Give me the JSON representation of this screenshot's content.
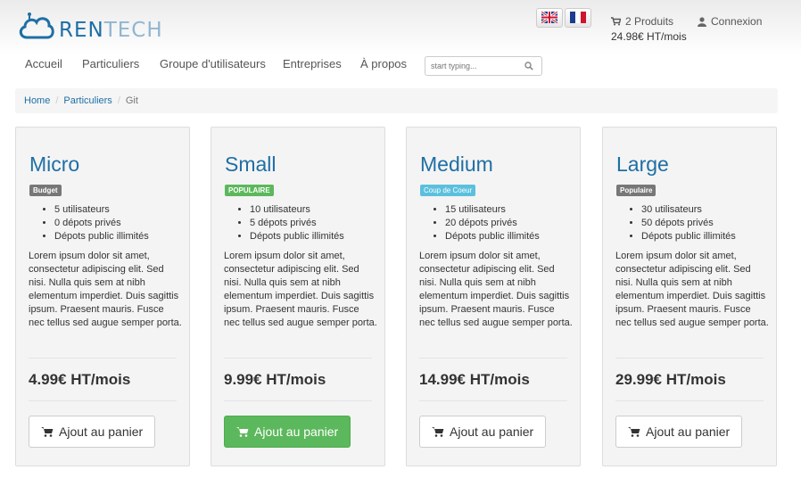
{
  "brand": {
    "logo_text_a": "REN",
    "logo_text_b": "TECH"
  },
  "header": {
    "cart": {
      "count": "2 Produits",
      "total": "24.98€ HT/mois"
    },
    "login_label": "Connexion"
  },
  "nav": {
    "items": [
      "Accueil",
      "Particuliers",
      "Groupe d'utilisateurs",
      "Entreprises",
      "À propos"
    ],
    "search_placeholder": "start typing..."
  },
  "breadcrumb": {
    "home": "Home",
    "section": "Particuliers",
    "current": "Git"
  },
  "colors": {
    "accent": "#1e6fa5",
    "budget": "#777777",
    "populaire_green": "#5cb85c",
    "coup_de_coeur": "#5bc0de",
    "populaire_gray": "#777777"
  },
  "plans": [
    {
      "name": "Micro",
      "badge": "Budget",
      "features": [
        "5 utilisateurs",
        "0 dépots privés",
        "Dépots public illimités"
      ],
      "description": "Lorem ipsum dolor sit amet, consectetur adipiscing elit. Sed nisi. Nulla quis sem at nibh elementum imperdiet. Duis sagittis ipsum. Praesent mauris. Fusce nec tellus sed augue semper porta.",
      "price": "4.99€ HT/mois",
      "button": "Ajout au panier"
    },
    {
      "name": "Small",
      "badge": "POPULAIRE",
      "features": [
        "10 utilisateurs",
        "5 dépots privés",
        "Dépots public illimités"
      ],
      "description": "Lorem ipsum dolor sit amet, consectetur adipiscing elit. Sed nisi. Nulla quis sem at nibh elementum imperdiet. Duis sagittis ipsum. Praesent mauris. Fusce nec tellus sed augue semper porta.",
      "price": "9.99€ HT/mois",
      "button": "Ajout au panier"
    },
    {
      "name": "Medium",
      "badge": "Coup de Coeur",
      "features": [
        "15 utilisateurs",
        "20 dépots privés",
        "Dépots public illimités"
      ],
      "description": "Lorem ipsum dolor sit amet, consectetur adipiscing elit. Sed nisi. Nulla quis sem at nibh elementum imperdiet. Duis sagittis ipsum. Praesent mauris. Fusce nec tellus sed augue semper porta.",
      "price": "14.99€ HT/mois",
      "button": "Ajout au panier"
    },
    {
      "name": "Large",
      "badge": "Populaire",
      "features": [
        "30 utilisateurs",
        "50 dépots privés",
        "Dépots public illimités"
      ],
      "description": "Lorem ipsum dolor sit amet, consectetur adipiscing elit. Sed nisi. Nulla quis sem at nibh elementum imperdiet. Duis sagittis ipsum. Praesent mauris. Fusce nec tellus sed augue semper porta.",
      "price": "29.99€ HT/mois",
      "button": "Ajout au panier"
    }
  ]
}
